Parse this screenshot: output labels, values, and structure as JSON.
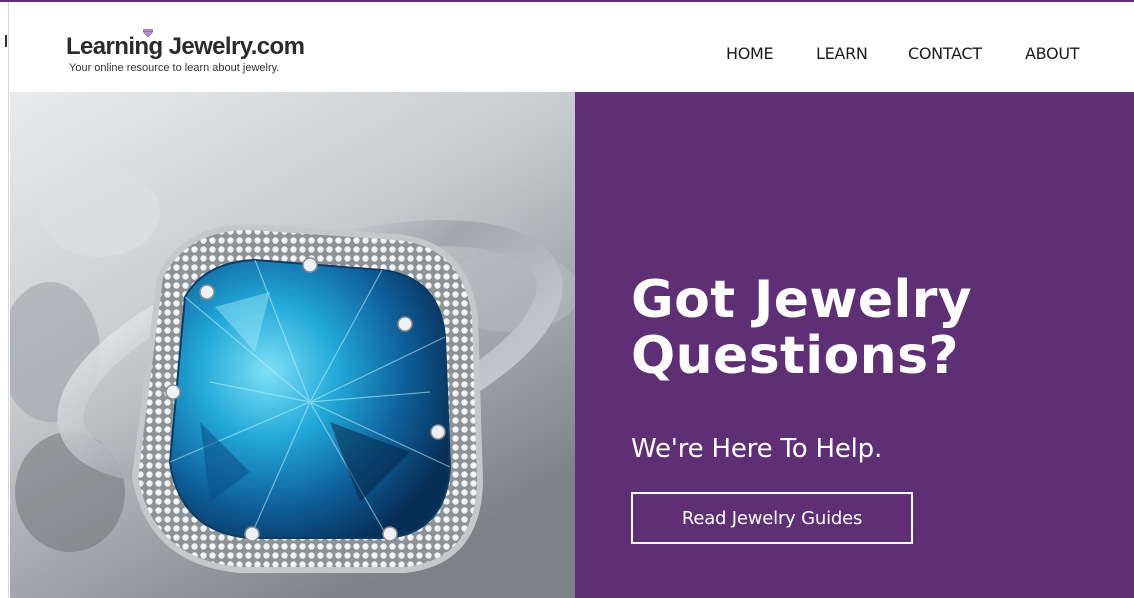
{
  "header": {
    "logo_title": "Learning Jewelry.com",
    "logo_tagline": "Your online resource to learn about jewelry.",
    "logo_icon": "diamond-icon"
  },
  "nav": {
    "items": [
      {
        "label": "HOME"
      },
      {
        "label": "LEARN"
      },
      {
        "label": "CONTACT"
      },
      {
        "label": "ABOUT"
      }
    ]
  },
  "hero": {
    "title": "Got Jewelry Questions?",
    "subtitle": "We're Here To Help.",
    "cta_label": "Read Jewelry Guides",
    "image": "blue-gemstone-ring-photo"
  },
  "colors": {
    "brand_purple": "#5e2f74",
    "text_dark": "#1b1b1b",
    "white": "#ffffff",
    "gem_blue": "#1fa9d6"
  }
}
